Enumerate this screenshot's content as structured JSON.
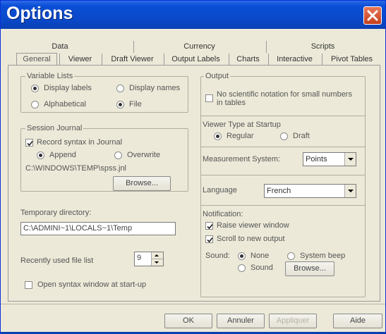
{
  "window": {
    "title": "Options"
  },
  "tabs_row1": [
    "Data",
    "Currency",
    "Scripts"
  ],
  "tabs_row2": [
    "General",
    "Viewer",
    "Draft Viewer",
    "Output Labels",
    "Charts",
    "Interactive",
    "Pivot Tables"
  ],
  "selected_tab": "General",
  "variable_lists": {
    "label": "Variable Lists",
    "display_labels": "Display labels",
    "display_names": "Display names",
    "alphabetical": "Alphabetical",
    "file": "File",
    "selected_display": "Display labels",
    "selected_order": "File"
  },
  "session_journal": {
    "label": "Session Journal",
    "record_syntax": "Record syntax in Journal",
    "record_checked": true,
    "append": "Append",
    "overwrite": "Overwrite",
    "selected_mode": "Append",
    "path": "C:\\WINDOWS\\TEMP\\spss.jnl",
    "browse": "Browse..."
  },
  "temporary_directory": {
    "label": "Temporary directory:",
    "value": "C:\\ADMINI~1\\LOCALS~1\\Temp"
  },
  "recent_files": {
    "label": "Recently used file list",
    "value": "9"
  },
  "open_syntax": {
    "label": "Open syntax window at start-up",
    "checked": false
  },
  "output": {
    "label": "Output",
    "no_sci_line1": "No scientific notation for small numbers",
    "no_sci_line2": "in tables",
    "no_sci_checked": false
  },
  "viewer_type": {
    "label": "Viewer Type at Startup",
    "regular": "Regular",
    "draft": "Draft",
    "selected": "Regular"
  },
  "measurement": {
    "label": "Measurement System:",
    "value": "Points"
  },
  "language": {
    "label": "Language",
    "value": "French"
  },
  "notification": {
    "label": "Notification:",
    "raise_viewer": "Raise viewer window",
    "raise_checked": true,
    "scroll_output": "Scroll to new output",
    "scroll_checked": true
  },
  "sound": {
    "label": "Sound:",
    "none": "None",
    "system_beep": "System beep",
    "sound": "Sound",
    "selected": "None",
    "browse": "Browse..."
  },
  "footer": {
    "ok": "OK",
    "cancel": "Annuler",
    "apply": "Appliquer",
    "help": "Aide"
  }
}
